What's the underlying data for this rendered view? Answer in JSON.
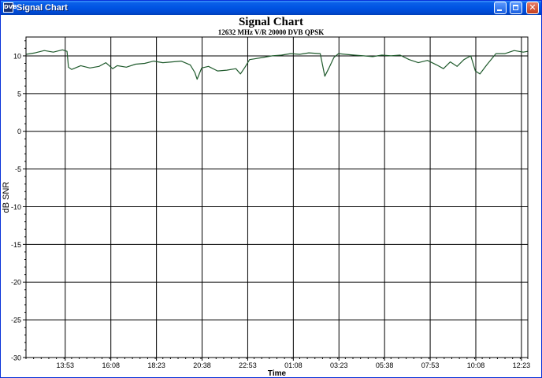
{
  "window": {
    "title": "Signal Chart",
    "app_icon_text": "DVB",
    "buttons": {
      "minimize_icon": "minimize-icon",
      "maximize_icon": "maximize-icon",
      "close_glyph": "✕"
    }
  },
  "colors": {
    "titlebar": "#0054e3",
    "line": "#1f5a2c",
    "grid": "#000000",
    "zero_line": "#000000",
    "background": "#ffffff"
  },
  "chart_data": {
    "type": "line",
    "title": "Signal Chart",
    "subtitle": "12632 MHz V/R 20000 DVB QPSK",
    "xlabel": "Time",
    "ylabel": "dB SNR",
    "ylim": [
      -30,
      12.5
    ],
    "yticks": [
      -30,
      -25,
      -20,
      -15,
      -10,
      -5,
      0,
      5,
      10
    ],
    "ytick_labels": [
      "-30",
      "-25",
      "-20",
      "-15",
      "-10",
      "-5",
      "0",
      "5",
      "10"
    ],
    "xlim": [
      0,
      11
    ],
    "xticks": [
      0.86,
      1.86,
      2.86,
      3.86,
      4.86,
      5.86,
      6.86,
      7.86,
      8.86,
      9.86,
      10.86
    ],
    "xtick_labels": [
      "13:53",
      "16:08",
      "18:23",
      "20:38",
      "22:53",
      "01:08",
      "03:23",
      "05:38",
      "07:53",
      "10:08",
      "12:23"
    ],
    "grid": true,
    "legend": "none",
    "series": [
      {
        "color": "#1f5a2c",
        "points": [
          [
            0.0,
            10.2
          ],
          [
            0.2,
            10.4
          ],
          [
            0.4,
            10.7
          ],
          [
            0.6,
            10.5
          ],
          [
            0.8,
            10.8
          ],
          [
            0.9,
            10.6
          ],
          [
            0.93,
            8.5
          ],
          [
            1.0,
            8.2
          ],
          [
            1.2,
            8.7
          ],
          [
            1.4,
            8.4
          ],
          [
            1.6,
            8.6
          ],
          [
            1.75,
            9.1
          ],
          [
            1.9,
            8.3
          ],
          [
            2.0,
            8.7
          ],
          [
            2.2,
            8.5
          ],
          [
            2.4,
            8.9
          ],
          [
            2.6,
            9.0
          ],
          [
            2.8,
            9.3
          ],
          [
            3.0,
            9.1
          ],
          [
            3.2,
            9.2
          ],
          [
            3.4,
            9.3
          ],
          [
            3.6,
            8.8
          ],
          [
            3.7,
            7.8
          ],
          [
            3.75,
            6.9
          ],
          [
            3.85,
            8.4
          ],
          [
            4.0,
            8.6
          ],
          [
            4.2,
            8.0
          ],
          [
            4.4,
            8.1
          ],
          [
            4.6,
            8.3
          ],
          [
            4.7,
            7.6
          ],
          [
            4.8,
            8.5
          ],
          [
            4.9,
            9.5
          ],
          [
            5.0,
            9.6
          ],
          [
            5.2,
            9.8
          ],
          [
            5.4,
            10.0
          ],
          [
            5.6,
            10.1
          ],
          [
            5.8,
            10.3
          ],
          [
            6.0,
            10.2
          ],
          [
            6.2,
            10.4
          ],
          [
            6.45,
            10.3
          ],
          [
            6.55,
            7.3
          ],
          [
            6.65,
            8.5
          ],
          [
            6.75,
            9.8
          ],
          [
            6.85,
            10.3
          ],
          [
            7.0,
            10.2
          ],
          [
            7.2,
            10.1
          ],
          [
            7.4,
            10.0
          ],
          [
            7.6,
            9.9
          ],
          [
            7.8,
            10.1
          ],
          [
            8.0,
            10.0
          ],
          [
            8.2,
            10.1
          ],
          [
            8.4,
            9.5
          ],
          [
            8.6,
            9.1
          ],
          [
            8.8,
            9.4
          ],
          [
            9.0,
            8.8
          ],
          [
            9.15,
            8.3
          ],
          [
            9.3,
            9.2
          ],
          [
            9.45,
            8.6
          ],
          [
            9.6,
            9.5
          ],
          [
            9.75,
            10.0
          ],
          [
            9.85,
            8.0
          ],
          [
            9.95,
            7.6
          ],
          [
            10.1,
            8.8
          ],
          [
            10.3,
            10.3
          ],
          [
            10.5,
            10.3
          ],
          [
            10.7,
            10.7
          ],
          [
            10.9,
            10.5
          ],
          [
            11.0,
            10.6
          ]
        ]
      }
    ]
  }
}
